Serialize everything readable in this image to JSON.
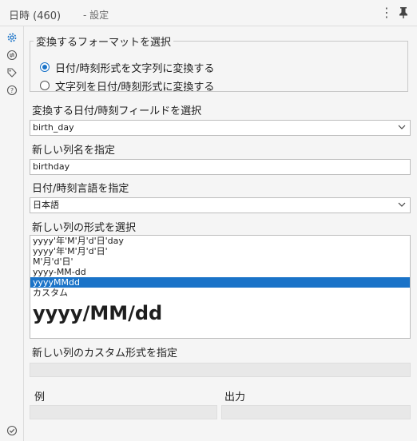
{
  "header": {
    "title": "日時 (460)",
    "subtitle": "- 設定",
    "more_icon": "kebab-icon",
    "pin_icon": "pin-icon"
  },
  "rail": {
    "icons": [
      "gear-icon",
      "arrows-icon",
      "tag-icon",
      "help-icon",
      "check-circle-icon"
    ]
  },
  "format_group": {
    "legend": "変換するフォーマットを選択",
    "options": [
      {
        "label": "日付/時刻形式を文字列に変換する",
        "selected": true
      },
      {
        "label": "文字列を日付/時刻形式に変換する",
        "selected": false
      }
    ]
  },
  "field_select": {
    "label": "変換する日付/時刻フィールドを選択",
    "value": "birth_day"
  },
  "new_column": {
    "label": "新しい列名を指定",
    "value": "birthday"
  },
  "language": {
    "label": "日付/時刻言語を指定",
    "value": "日本語"
  },
  "format_list": {
    "label": "新しい列の形式を選択",
    "options": [
      "yyyy'年'M'月'd'日'day",
      "yyyy'年'M'月'd'日'",
      "M'月'd'日'",
      "yyyy-MM-dd",
      "yyyyMMdd",
      "カスタム"
    ],
    "selected_index": 4,
    "preview": "yyyy/MM/dd"
  },
  "custom_format": {
    "label": "新しい列のカスタム形式を指定"
  },
  "example": {
    "example_label": "例",
    "output_label": "出力"
  },
  "colors": {
    "accent": "#1a73c8",
    "background": "#f5f5f5"
  }
}
